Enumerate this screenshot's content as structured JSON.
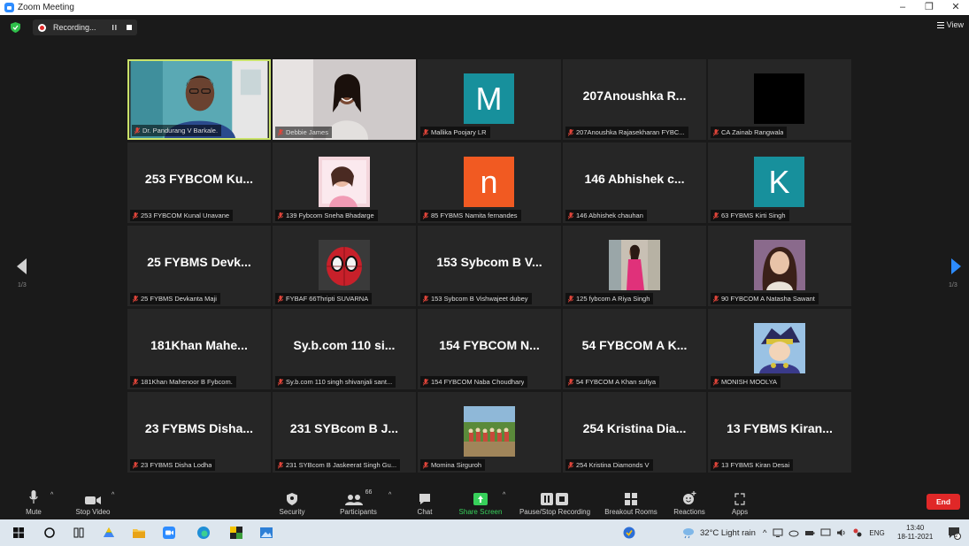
{
  "window": {
    "title": "Zoom Meeting",
    "min": "–",
    "restore": "❐",
    "close": "✕"
  },
  "topbar": {
    "recording_label": "Recording...",
    "pause_symbol": "II",
    "view_label": "View"
  },
  "pager": {
    "left_label": "1/3",
    "right_label": "1/3"
  },
  "colors": {
    "active_border": "#c9e26a",
    "end_red": "#e02828",
    "green": "#37d05a",
    "mic_red": "#e0453a"
  },
  "tiles": [
    {
      "label": "Dr. Pandurang V Barkale.",
      "kind": "video",
      "active": true
    },
    {
      "label": "Debbie James",
      "kind": "video"
    },
    {
      "label": "Mallika Poojary LR",
      "kind": "letter",
      "letter": "M",
      "color": "#17909c"
    },
    {
      "label": "207Anoushka Rajasekharan FYBC...",
      "kind": "name",
      "display": "207Anoushka R..."
    },
    {
      "label": "CA Zainab Rangwala",
      "kind": "black"
    },
    {
      "label": "253 FYBCOM Kunal Unavane",
      "kind": "name",
      "display": "253 FYBCOM Ku..."
    },
    {
      "label": "139 Fybcom Sneha Bhadarge",
      "kind": "photo",
      "photo": "pink"
    },
    {
      "label": "85 FYBMS Namita fernandes",
      "kind": "letter",
      "letter": "n",
      "color": "#f15a22"
    },
    {
      "label": "146 Abhishek chauhan",
      "kind": "name",
      "display": "146 Abhishek c..."
    },
    {
      "label": "63 FYBMS Kirti Singh",
      "kind": "letter",
      "letter": "K",
      "color": "#17909c"
    },
    {
      "label": "25 FYBMS Devkanta Maji",
      "kind": "name",
      "display": "25 FYBMS Devk..."
    },
    {
      "label": "FYBAF 66Thripti SUVARNA",
      "kind": "photo",
      "photo": "spider"
    },
    {
      "label": "153 Sybcom B Vishwajeet dubey",
      "kind": "name",
      "display": "153 Sybcom B V..."
    },
    {
      "label": "125 fybcom A Riya Singh",
      "kind": "photo",
      "photo": "girl"
    },
    {
      "label": "90 FYBCOM A Natasha Sawant",
      "kind": "photo",
      "photo": "woman"
    },
    {
      "label": "181Khan Mahenoor B Fybcom.",
      "kind": "name",
      "display": "181Khan Mahe..."
    },
    {
      "label": "Sy.b.com 110 singh shivanjali sant...",
      "kind": "name",
      "display": "Sy.b.com 110 si..."
    },
    {
      "label": "154 FYBCOM Naba Choudhary",
      "kind": "name",
      "display": "154 FYBCOM N..."
    },
    {
      "label": "54 FYBCOM A Khan sufiya",
      "kind": "name",
      "display": "54 FYBCOM A K..."
    },
    {
      "label": "MONISH MOOLYA",
      "kind": "photo",
      "photo": "anime"
    },
    {
      "label": "23 FYBMS Disha Lodha",
      "kind": "name",
      "display": "23 FYBMS Disha..."
    },
    {
      "label": "231 SYBcom B Jaskeerat Singh Gu...",
      "kind": "name",
      "display": "231 SYBcom B J..."
    },
    {
      "label": "Momina Sirguroh",
      "kind": "photo",
      "photo": "group"
    },
    {
      "label": "254 Kristina Diamonds V",
      "kind": "name",
      "display": "254 Kristina Dia..."
    },
    {
      "label": "13 FYBMS Kiran Desai",
      "kind": "name",
      "display": "13 FYBMS Kiran..."
    }
  ],
  "toolbar": {
    "mute": "Mute",
    "stop_video": "Stop Video",
    "security": "Security",
    "participants": "Participants",
    "participant_count": "66",
    "chat": "Chat",
    "share_screen": "Share Screen",
    "pause_recording": "Pause/Stop Recording",
    "breakout": "Breakout Rooms",
    "reactions": "Reactions",
    "apps": "Apps",
    "end": "End"
  },
  "taskbar": {
    "weather": "32°C  Light rain",
    "language": "ENG",
    "time": "13:40",
    "date": "18-11-2021",
    "notif_count": "2"
  }
}
